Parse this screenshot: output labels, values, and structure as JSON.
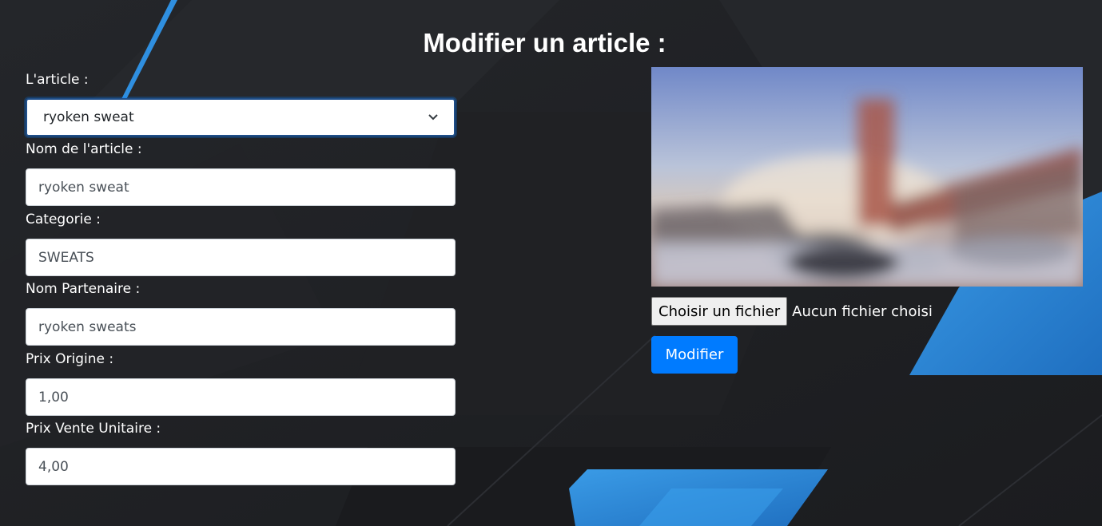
{
  "page": {
    "title": "Modifier un article :"
  },
  "form": {
    "article_select": {
      "label": "L'article :",
      "selected": "ryoken sweat"
    },
    "name": {
      "label": "Nom de l'article :",
      "value": "ryoken sweat"
    },
    "category": {
      "label": "Categorie :",
      "value": "SWEATS"
    },
    "partner": {
      "label": "Nom Partenaire :",
      "value": "ryoken sweats"
    },
    "origin_price": {
      "label": "Prix Origine :",
      "value": "1,00"
    },
    "unit_price": {
      "label": "Prix Vente Unitaire :",
      "value": "4,00"
    }
  },
  "upload": {
    "button_label": "Choisir un fichier",
    "status": "Aucun fichier choisi"
  },
  "actions": {
    "submit_label": "Modifier"
  },
  "icons": {
    "select_arrow": "chevron-down-icon"
  },
  "colors": {
    "background": "#1e1f22",
    "accent_blue": "#2d87d3",
    "primary_button": "#007bff"
  }
}
